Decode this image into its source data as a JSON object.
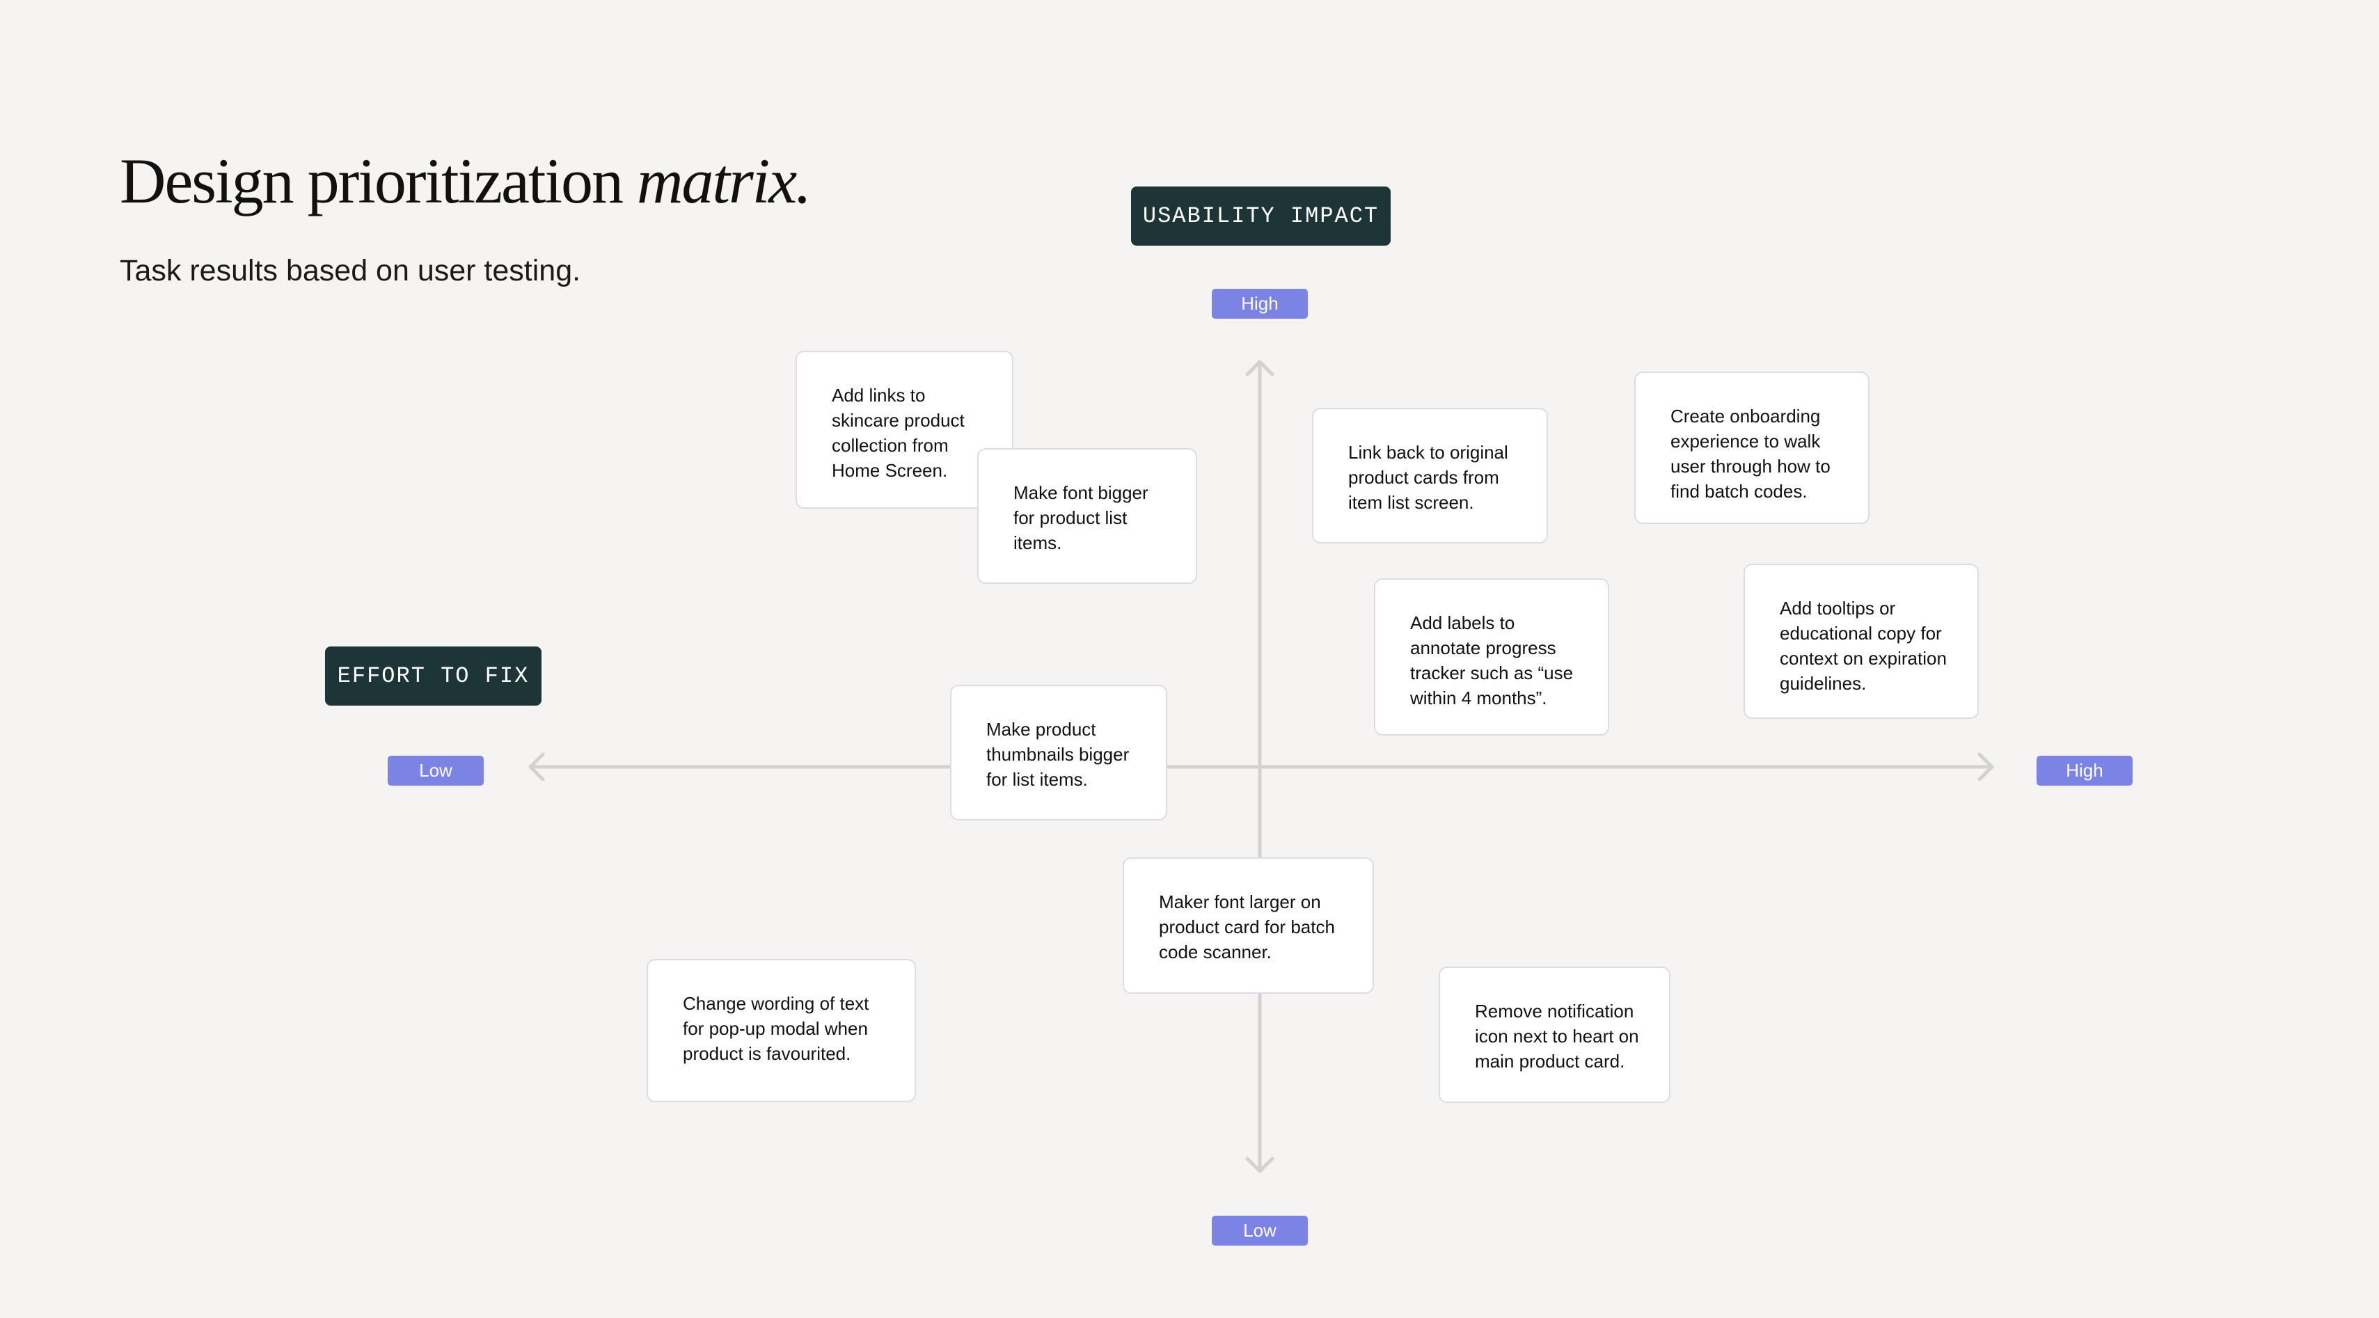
{
  "header": {
    "title_main": "Design prioritization",
    "title_italic": "matrix.",
    "subtitle": "Task results based on user testing."
  },
  "axes": {
    "vertical": {
      "label": "USABILITY IMPACT",
      "high": "High",
      "low": "Low"
    },
    "horizontal": {
      "label": "EFFORT TO FIX",
      "low": "Low",
      "high": "High"
    }
  },
  "colors": {
    "background": "#f5f4f2",
    "dark_label": "#1d3537",
    "pill": "#7b83e4",
    "axis_line": "#d2d2d2",
    "card_border": "#dcdce8"
  },
  "cards": [
    "Add links to skincare product collection from Home Screen.",
    "Make font bigger for product list items.",
    "Link back to original product cards from item list screen.",
    "Create onboarding experience to walk user through how to find batch codes.",
    "Add labels to annotate progress tracker such as “use within 4 months”.",
    "Add tooltips or educational copy for context on expiration guidelines.",
    "Make product thumbnails bigger for list items.",
    "Maker font larger on product card for batch code scanner.",
    "Change wording of text for pop-up modal when product is favourited.",
    "Remove notification icon next to heart on main product card."
  ]
}
